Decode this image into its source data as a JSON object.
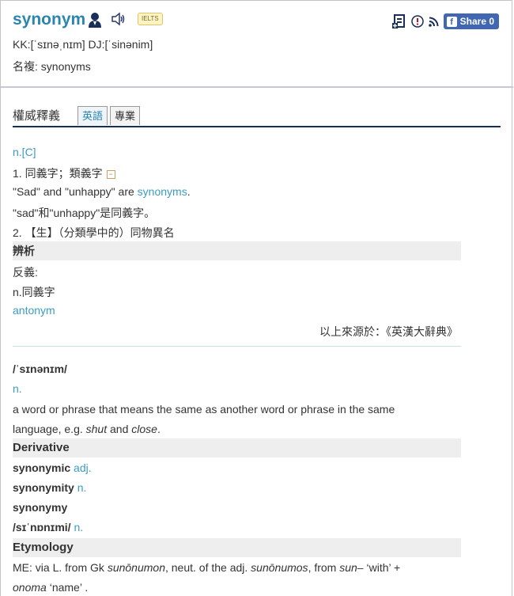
{
  "header": {
    "word": "synonym",
    "ielts_badge": "IELTS",
    "phonetic": "KK:[ˈsɪnəˌnɪm] DJ:[ˈsinənim]",
    "plural": "名複: synonyms",
    "share_label": "Share 0",
    "share_icon_glyph": "f"
  },
  "tabs": {
    "section_title": "權威釋義",
    "tab1": "英語",
    "tab2": "專業"
  },
  "def1": {
    "pos": "n.[C]",
    "sense1": "1. 同義字；類義字",
    "collapse_glyph": "−",
    "example_en_prefix": "\"Sad\" and \"unhappy\" are ",
    "example_en_link": "synonyms",
    "example_en_suffix": ".",
    "example_zh": "\"sad\"和\"unhappy\"是同義字。",
    "sense2": "2. 【生】（分類學中的）同物異名",
    "analysis_header": "辨析",
    "antonym_label": "反義:",
    "antonym_pos": "n.同義字",
    "antonym_word": "antonym",
    "source": "以上來源於：《英漢大辭典》"
  },
  "def2": {
    "phonetic": "/ˈsɪnənɪm/",
    "pos": "n.",
    "definition_line1": "a word or phrase that means the same as another word or phrase in the same",
    "definition_line2_prefix": "language, e.g. ",
    "eg_word1": "shut",
    "and_word": " and ",
    "eg_word2": "close",
    "period": ".",
    "derivative_header": "Derivative",
    "derivatives": [
      {
        "word": "synonymic",
        "pos": " adj."
      },
      {
        "word": "synonymity",
        "pos": " n."
      },
      {
        "word": "synonymy",
        "pos": ""
      }
    ],
    "deriv_phon": "/sɪˈnɒnɪmi/",
    "deriv_phon_pos": " n.",
    "etymology_header": "Etymology",
    "etym_line1_a": "ME: via L. from Gk ",
    "etym_word1": "sunōnumon",
    "etym_line1_b": ", neut. of the adj. ",
    "etym_word2": "sunōnumos",
    "etym_line1_c": ", from ",
    "etym_word3": "sun–",
    "etym_line1_d": " ‘with’ + ",
    "etym_word4": "onoma",
    "etym_line2_b": " ‘name’ ."
  }
}
